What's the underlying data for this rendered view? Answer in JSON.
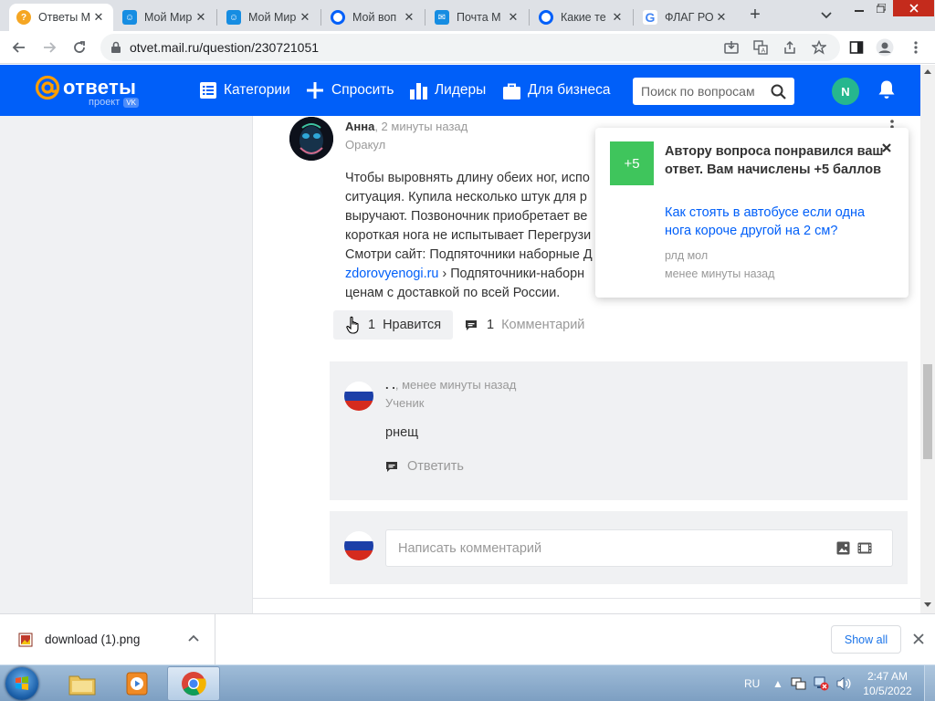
{
  "browser": {
    "tabs": [
      {
        "title": "Ответы M",
        "icon": "question-icon",
        "color": "#f5a623"
      },
      {
        "title": "Мой Мир",
        "icon": "moimir-icon",
        "color": "#168de2"
      },
      {
        "title": "Мой Мир",
        "icon": "moimir-icon",
        "color": "#168de2"
      },
      {
        "title": "Мой воп",
        "icon": "answers-circle-icon",
        "color": "#005ff9"
      },
      {
        "title": "Почта M",
        "icon": "mail-icon",
        "color": "#168de2"
      },
      {
        "title": "Какие те",
        "icon": "answers-circle-icon",
        "color": "#005ff9"
      },
      {
        "title": "ФЛАГ РО",
        "icon": "google-icon",
        "color": "#4285f4"
      }
    ],
    "new_tab": "+",
    "url": "otvet.mail.ru/question/230721051"
  },
  "site": {
    "logo_text": "ответы",
    "logo_sub": "проект",
    "logo_vk": "VK",
    "nav": [
      {
        "label": "Категории",
        "icon": "categories-icon"
      },
      {
        "label": "Спросить",
        "icon": "plus-icon"
      },
      {
        "label": "Лидеры",
        "icon": "leaders-icon"
      },
      {
        "label": "Для бизнеса",
        "icon": "business-icon"
      }
    ],
    "search_placeholder": "Поиск по вопросам",
    "user_initial": "N"
  },
  "answer": {
    "author": "Анна",
    "time": ", 2 минуты назад",
    "rank": "Оракул",
    "lines": [
      "Чтобы выровнять длину обеих ног, испо",
      "ситуация. Купила несколько штук для р",
      "выручают. Позвоночник приобретает ве",
      "короткая нога не испытывает Перегрузи",
      "Смотри сайт: Подпяточники наборные Д"
    ],
    "link_line": {
      "link": "zdorovyenogi.ru",
      "rest": " › Подпяточники-наборн"
    },
    "last_line": "ценам с доставкой по всей России.",
    "likes_count": "1",
    "likes_label": "Нравится",
    "comments_count": "1",
    "comments_label": "Комментарий"
  },
  "comment": {
    "author": ". .",
    "time": ", менее минуты назад",
    "rank": "Ученик",
    "text": "рнещ",
    "reply_label": "Ответить"
  },
  "write_comment": {
    "placeholder": "Написать комментарий"
  },
  "toast": {
    "badge": "+5",
    "title": "Автору вопроса понравился ваш ответ. Вам начислены +5 баллов",
    "link": "Как стоять в автобусе если одна нога короче другой на 2 см?",
    "user": "рлд мол",
    "time": "менее минуты назад"
  },
  "downloads": {
    "file_name": "download (1).png",
    "show_all": "Show all"
  },
  "taskbar": {
    "language": "RU",
    "time": "2:47 AM",
    "date": "10/5/2022"
  },
  "colors": {
    "brand_blue": "#005ff9",
    "toast_green": "#3fc55c",
    "avatar_green": "#26b78e"
  }
}
